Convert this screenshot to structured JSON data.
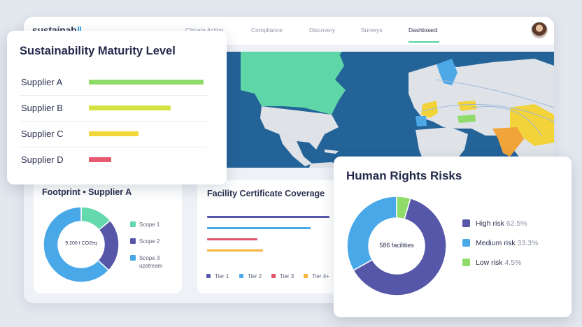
{
  "app": {
    "logo": "sustainab",
    "nav": [
      "Climate Action",
      "Compliance",
      "Discovery",
      "Surveys",
      "Dashboard"
    ],
    "active_nav": "Dashboard"
  },
  "maturity": {
    "title": "Sustainability Maturity Level",
    "suppliers": [
      {
        "label": "Supplier A",
        "level": 0.92,
        "color": "#8fdc6a"
      },
      {
        "label": "Supplier B",
        "level": 0.66,
        "color": "#d3e23f"
      },
      {
        "label": "Supplier C",
        "level": 0.4,
        "color": "#f1d73a"
      },
      {
        "label": "Supplier D",
        "level": 0.18,
        "color": "#e85a70"
      }
    ]
  },
  "footprint": {
    "title": "Footprint • Supplier A",
    "center_label": "9.200 t CO2eq",
    "legend": [
      {
        "label": "Scope 1",
        "color": "#63d9ad"
      },
      {
        "label": "Scope 2",
        "color": "#5657a8"
      },
      {
        "label": "Scope 3 upstream",
        "color": "#49a8e8"
      }
    ],
    "shares": [
      0.14,
      0.23,
      0.63
    ]
  },
  "facility": {
    "title": "Facility Certificate Coverage",
    "bars": [
      {
        "name": "Tier 1",
        "value": 0.92,
        "color": "#5657a8"
      },
      {
        "name": "Tier 2",
        "value": 0.78,
        "color": "#49a8e8"
      },
      {
        "name": "Tier 3",
        "value": 0.38,
        "color": "#e0546a"
      },
      {
        "name": "Tier 4+",
        "value": 0.42,
        "color": "#f4b43e"
      }
    ],
    "legend": [
      "Tier 1",
      "Tier 2",
      "Tier 3",
      "Tier 4+"
    ]
  },
  "human_rights": {
    "title": "Human Rights Risks",
    "center_label": "586 facilities",
    "legend": [
      {
        "label": "High risk",
        "pct": "62.5%",
        "color": "#5657a8",
        "value": 62.5
      },
      {
        "label": "Medium risk",
        "pct": "33.3%",
        "color": "#49a8e8",
        "value": 33.3
      },
      {
        "label": "Low risk",
        "pct": "4.5%",
        "color": "#8fdc6a",
        "value": 4.5
      }
    ]
  }
}
